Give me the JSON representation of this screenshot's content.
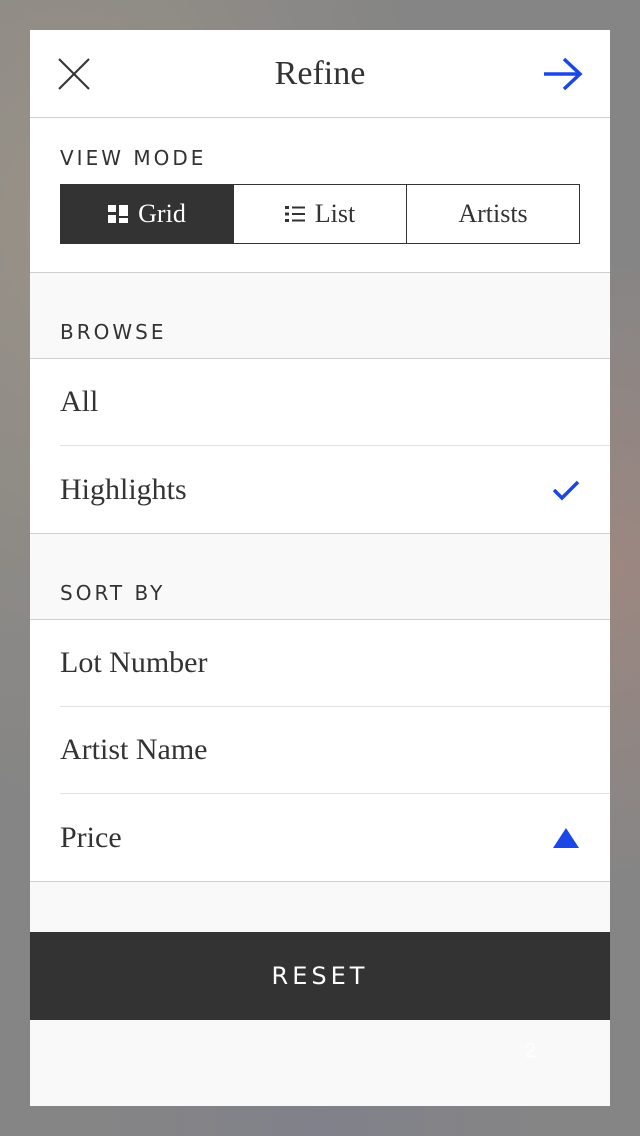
{
  "header": {
    "title": "Refine"
  },
  "view_mode": {
    "label": "VIEW MODE",
    "options": [
      {
        "label": "Grid",
        "icon": "grid-icon",
        "selected": true
      },
      {
        "label": "List",
        "icon": "list-icon",
        "selected": false
      },
      {
        "label": "Artists",
        "selected": false
      }
    ]
  },
  "browse": {
    "label": "BROWSE",
    "items": [
      {
        "label": "All",
        "selected": false
      },
      {
        "label": "Highlights",
        "selected": true,
        "indicator": "checkmark-icon"
      }
    ]
  },
  "sort_by": {
    "label": "SORT BY",
    "items": [
      {
        "label": "Lot Number"
      },
      {
        "label": "Artist Name"
      },
      {
        "label": "Price",
        "indicator": "sort-ascending-icon"
      }
    ]
  },
  "reset_label": "RESET",
  "footer_number": "2",
  "colors": {
    "accent": "#1a47e6",
    "dark": "#333333",
    "background": "#f9f9f9"
  }
}
